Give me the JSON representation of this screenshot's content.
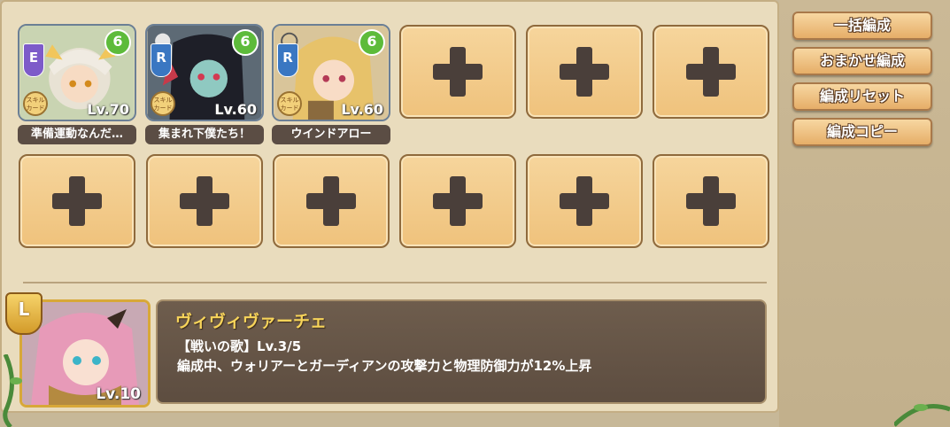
{
  "party": {
    "members": [
      {
        "rarity": "E",
        "rarity_color": "#7d5bc9",
        "level": "Lv.70",
        "skill_name": "準備運動なんだ…",
        "element": "6"
      },
      {
        "rarity": "R",
        "rarity_color": "#3a77c2",
        "level": "Lv.60",
        "skill_name": "集まれ下僕たち！",
        "element": "6"
      },
      {
        "rarity": "R",
        "rarity_color": "#3a77c2",
        "level": "Lv.60",
        "skill_name": "ウインドアロー",
        "element": "6"
      }
    ],
    "skill_medal_text": "スキルカード",
    "empty_slot_count": 9
  },
  "side_menu": {
    "bulk_form": "一括編成",
    "auto_form": "おまかせ編成",
    "reset_form": "編成リセット",
    "copy_form": "編成コピー"
  },
  "leader": {
    "badge": "L",
    "level": "Lv.10",
    "name": "ヴィヴィヴァーチェ",
    "skill_title": "【戦いの歌】Lv.3/5",
    "skill_desc": "編成中、ウォリアーとガーディアンの攻撃力と物理防御力が12%上昇"
  },
  "colors": {
    "slot_fill": "#efc27c",
    "panel_bg": "#e9dcbd",
    "accent_gold": "#f7d45a"
  }
}
